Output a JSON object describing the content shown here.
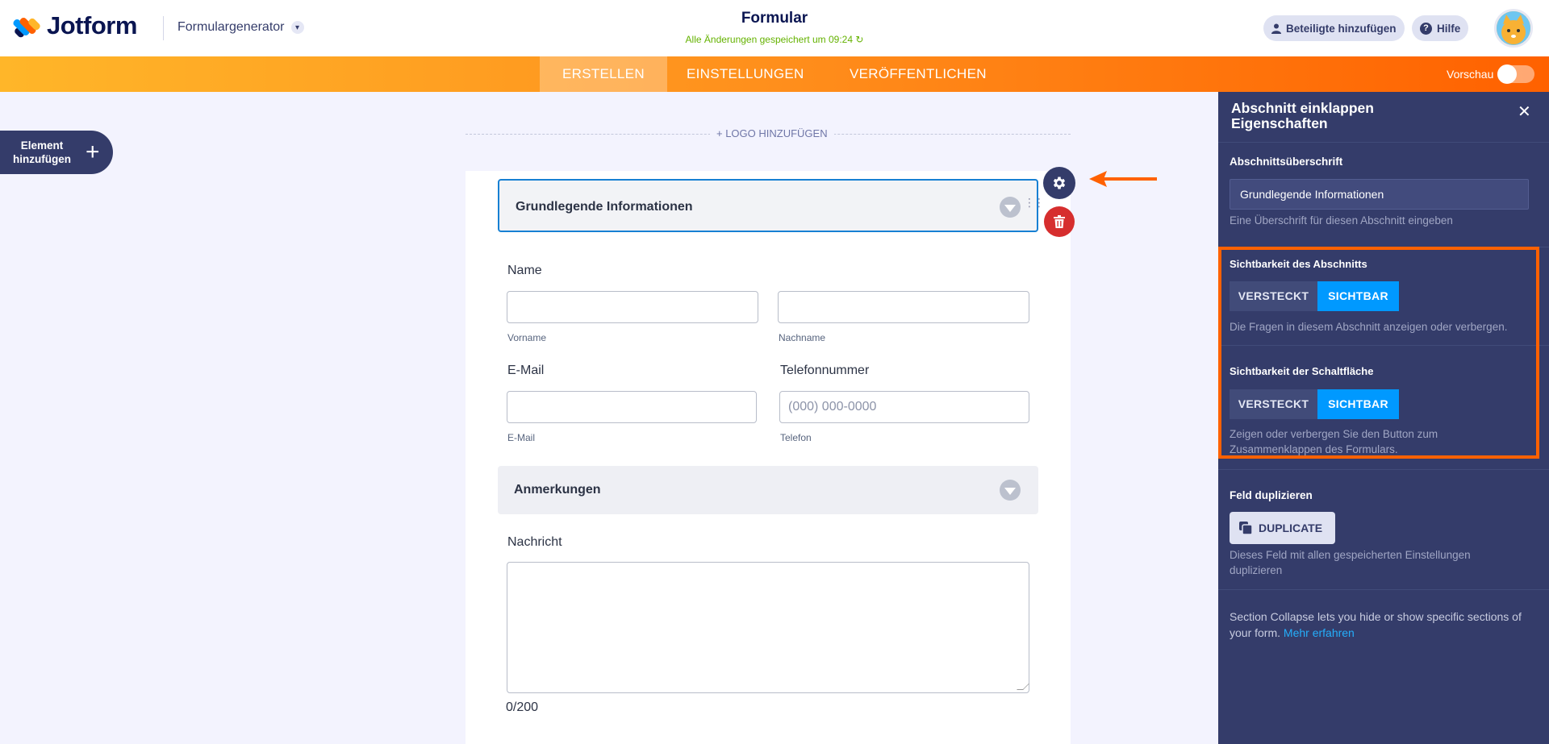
{
  "header": {
    "brand": "Jotform",
    "form_generator": "Formulargenerator",
    "form_title": "Formular",
    "saved_status": "Alle Änderungen gespeichert um 09:24",
    "add_participants": "Beteiligte hinzufügen",
    "help": "Hilfe"
  },
  "nav": {
    "tabs": [
      {
        "label": "ERSTELLEN",
        "active": true
      },
      {
        "label": "EINSTELLUNGEN",
        "active": false
      },
      {
        "label": "VERÖFFENTLICHEN",
        "active": false
      }
    ],
    "preview_label": "Vorschau"
  },
  "builder": {
    "add_element_line1": "Element",
    "add_element_line2": "hinzufügen",
    "add_logo": "+ LOGO HINZUFÜGEN"
  },
  "form": {
    "section1_title": "Grundlegende Informationen",
    "name_label": "Name",
    "first_name_sub": "Vorname",
    "last_name_sub": "Nachname",
    "email_label": "E-Mail",
    "email_sub": "E-Mail",
    "phone_label": "Telefonnummer",
    "phone_placeholder": "(000) 000-0000",
    "phone_sub": "Telefon",
    "section2_title": "Anmerkungen",
    "message_label": "Nachricht",
    "char_count": "0/200"
  },
  "panel": {
    "title_line1": "Abschnitt einklappen",
    "title_line2": "Eigenschaften",
    "heading_label": "Abschnittsüberschrift",
    "heading_value": "Grundlegende Informationen",
    "heading_desc": "Eine Überschrift für diesen Abschnitt eingeben",
    "section_visibility_label": "Sichtbarkeit des Abschnitts",
    "hidden": "VERSTECKT",
    "visible": "SICHTBAR",
    "section_visibility_desc": "Die Fragen in diesem Abschnitt anzeigen oder verbergen.",
    "button_visibility_label": "Sichtbarkeit der Schaltfläche",
    "button_visibility_desc_line1": "Zeigen oder verbergen Sie den Button zum",
    "button_visibility_desc_line2": "Zusammenklappen des Formulars.",
    "duplicate_label": "Feld duplizieren",
    "duplicate_button": "DUPLICATE",
    "duplicate_desc_line1": "Dieses Feld mit allen gespeicherten Einstellungen",
    "duplicate_desc_line2": "duplizieren",
    "info_text_line1": "Section Collapse lets you hide or show specific sections of",
    "info_text_line2": "your form.",
    "info_link": "Mehr erfahren"
  },
  "colors": {
    "accent_orange": "#ff6100",
    "panel_bg": "#343c6a",
    "toggle_active": "#0099ff",
    "delete_red": "#d62e2e"
  }
}
